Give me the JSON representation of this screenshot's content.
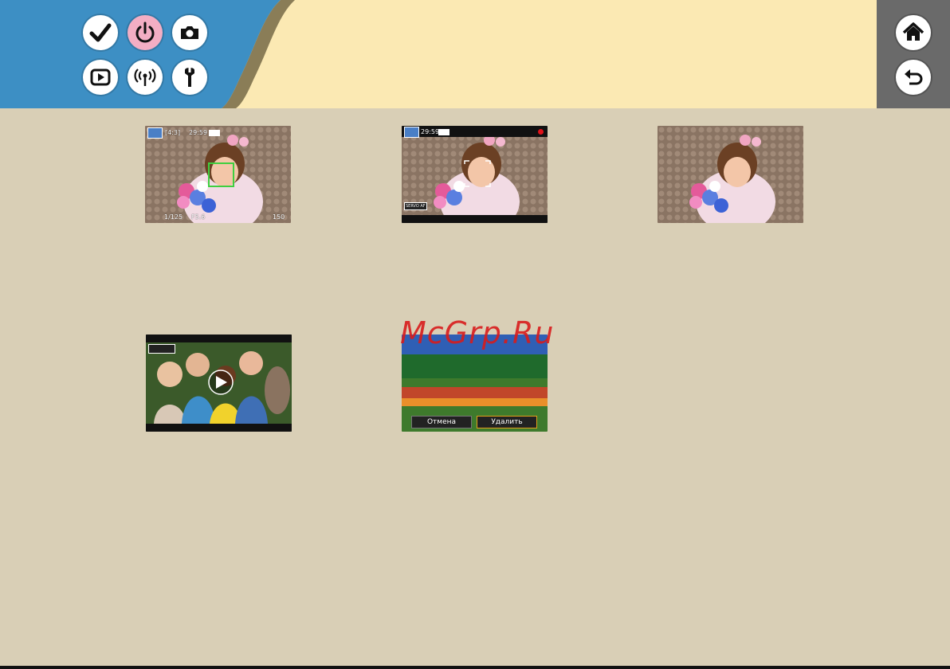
{
  "header": {
    "colors": {
      "bar": "#fbe9b3",
      "tab": "#3d8fc4",
      "tab_stripe": "#8a7d57",
      "panel": "#6a6a6a",
      "active_button": "#f3aec4"
    },
    "nav_buttons": [
      {
        "icon": "check-icon",
        "active": false
      },
      {
        "icon": "power-icon",
        "active": true
      },
      {
        "icon": "camera-icon",
        "active": false
      },
      {
        "icon": "playback-icon",
        "active": false
      },
      {
        "icon": "wireless-icon",
        "active": false
      },
      {
        "icon": "wrench-icon",
        "active": false
      }
    ],
    "side_buttons": [
      {
        "icon": "home-icon"
      },
      {
        "icon": "back-arrow-icon"
      }
    ]
  },
  "screens": {
    "shooting": {
      "top_left": "[4:3]",
      "time": "29:59",
      "bottom_left": "1/125",
      "bottom_mid": "F5.6",
      "bottom_right": "150"
    },
    "movie": {
      "time": "29:59",
      "mode_icon": "movie-mode-icon",
      "mode_label": "SERVO AF"
    },
    "delete": {
      "cancel": "Отмена",
      "delete": "Удалить"
    }
  },
  "watermark": "McGrp.Ru"
}
